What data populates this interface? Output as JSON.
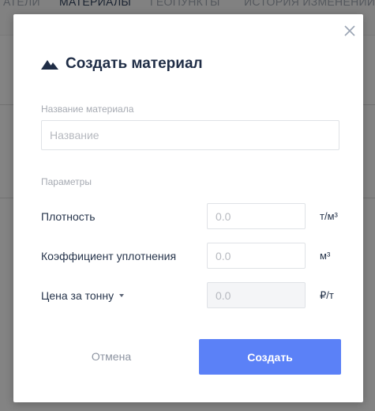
{
  "background": {
    "tabs": [
      "АТЕЛИ",
      "МАТЕРИАЛЫ",
      "ГЕОПУНКТЫ",
      "ИСТОРИЯ ИЗМЕНЕНИЙ"
    ]
  },
  "modal": {
    "title": "Создать материал",
    "title_icon": "mountain-icon",
    "close_icon": "close-icon",
    "name_field": {
      "label": "Название материала",
      "placeholder": "Название",
      "value": ""
    },
    "params_section_label": "Параметры",
    "params": [
      {
        "label": "Плотность",
        "placeholder": "0.0",
        "value": "",
        "unit": "т/м³",
        "has_dropdown": false,
        "disabled": false
      },
      {
        "label": "Коэффициент уплотнения",
        "placeholder": "0.0",
        "value": "",
        "unit": "м³",
        "has_dropdown": false,
        "disabled": false
      },
      {
        "label": "Цена за тонну",
        "placeholder": "0.0",
        "value": "",
        "unit": "₽/т",
        "has_dropdown": true,
        "disabled": true
      }
    ],
    "cancel_label": "Отмена",
    "create_label": "Создать"
  },
  "colors": {
    "accent": "#5b81f7",
    "title_text": "#1f2d46",
    "overlay": "rgba(0,0,0,0.45)"
  }
}
